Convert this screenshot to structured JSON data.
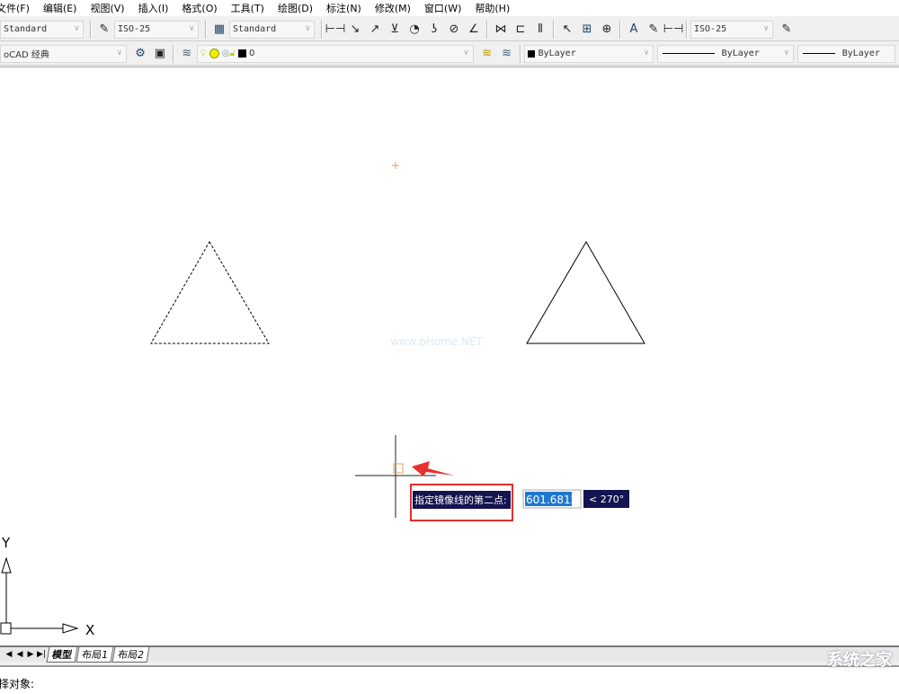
{
  "menu": [
    "文件(F)",
    "编辑(E)",
    "视图(V)",
    "插入(I)",
    "格式(O)",
    "工具(T)",
    "绘图(D)",
    "标注(N)",
    "修改(M)",
    "窗口(W)",
    "帮助(H)"
  ],
  "toolbar1": {
    "text_style": "Standard",
    "dim_style": "ISO-25",
    "table_style": "Standard",
    "dim_style2": "ISO-25"
  },
  "toolbar2": {
    "workspace": "oCAD 经典",
    "layer": "0",
    "color": "ByLayer",
    "linetype": "ByLayer",
    "lineweight": "ByLayer"
  },
  "canvas": {
    "watermark": "www.pHome.NET",
    "prompt_label": "指定镜像线的第二点:",
    "distance_value": "601.6812",
    "angle_value": "< 270°",
    "ucs_x": "X",
    "ucs_y": "Y",
    "colors": {
      "tooltip_bg": "#141450",
      "input_highlight": "#1e78d2",
      "highlight_box": "#e03030",
      "arrow": "#e83030",
      "snap_marker": "#e0a060"
    }
  },
  "tabs": [
    "模型",
    "布局1",
    "布局2"
  ],
  "command_line": "择对象:",
  "logo_text": "系统之家"
}
